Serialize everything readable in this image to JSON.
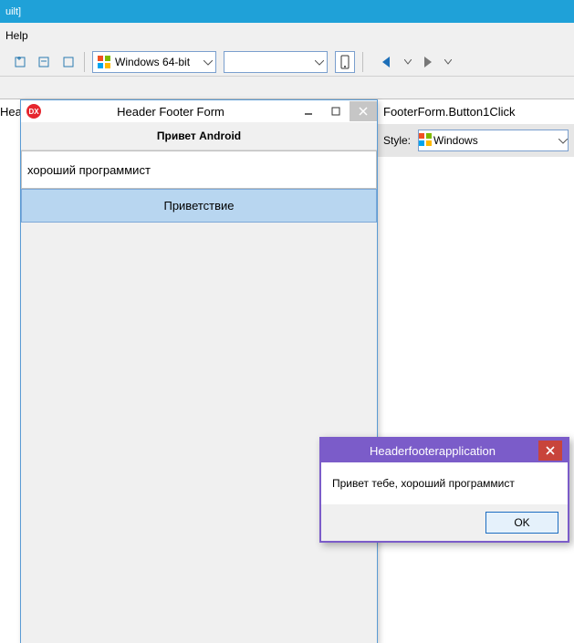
{
  "topbar": {
    "fragment": "uilt]"
  },
  "menu": {
    "help": "Help"
  },
  "toolbar": {
    "target": "Windows 64-bit",
    "device_empty": ""
  },
  "tabs": {
    "left_cut": "Hea"
  },
  "breadcrumb": "FooterForm.Button1Click",
  "style_panel": {
    "label": "Style:",
    "value": "Windows"
  },
  "hf": {
    "title": "Header Footer Form",
    "header": "Привет Android",
    "input_value": "хороший программист",
    "button": "Приветствие",
    "app_icon_text": "DX"
  },
  "dialog": {
    "title": "Headerfooterapplication",
    "message": "Привет тебе, хороший программист",
    "ok": "OK"
  }
}
